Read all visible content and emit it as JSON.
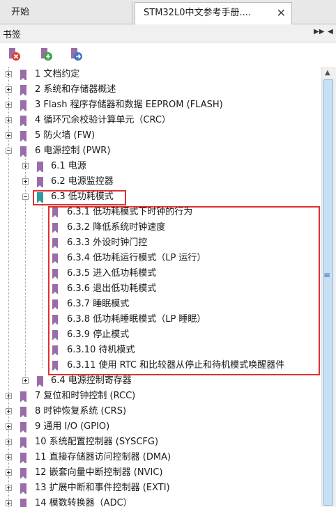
{
  "tabs": {
    "home": "开始",
    "doc": "STM32L0中文参考手册....",
    "close_symbol": "✕"
  },
  "panel": {
    "title": "书签",
    "controls": "▶▶ ◀"
  },
  "toolbar": {
    "delete_icon": "delete-bookmark-icon",
    "add_icon": "add-bookmark-icon",
    "goto_icon": "goto-bookmark-icon"
  },
  "tree": {
    "top": [
      {
        "label": "1 文档约定"
      },
      {
        "label": "2 系统和存储器概述"
      },
      {
        "label": "3 Flash 程序存储器和数据 EEPROM (FLASH)"
      },
      {
        "label": "4 循环冗余校验计算单元（CRC）"
      },
      {
        "label": "5 防火墙 (FW)"
      },
      {
        "label": "6 电源控制 (PWR)"
      }
    ],
    "sec6": [
      {
        "label": "6.1 电源"
      },
      {
        "label": "6.2 电源监控器"
      },
      {
        "label": "6.3 低功耗模式"
      }
    ],
    "sec63": [
      {
        "label": "6.3.1 低功耗模式下时钟的行为"
      },
      {
        "label": "6.3.2 降低系统时钟速度"
      },
      {
        "label": "6.3.3 外设时钟门控"
      },
      {
        "label": "6.3.4 低功耗运行模式（LP 运行）"
      },
      {
        "label": "6.3.5 进入低功耗模式"
      },
      {
        "label": "6.3.6 退出低功耗模式"
      },
      {
        "label": "6.3.7 睡眠模式"
      },
      {
        "label": "6.3.8 低功耗睡眠模式（LP 睡眠）"
      },
      {
        "label": "6.3.9 停止模式"
      },
      {
        "label": "6.3.10 待机模式"
      },
      {
        "label": "6.3.11 使用 RTC 和比较器从停止和待机模式唤醒器件"
      }
    ],
    "sec64": {
      "label": "6.4 电源控制寄存器"
    },
    "rest": [
      {
        "label": "7 复位和时钟控制 (RCC)"
      },
      {
        "label": "8 时钟恢复系统 (CRS)"
      },
      {
        "label": "9 通用 I/O (GPIO)"
      },
      {
        "label": "10 系统配置控制器 (SYSCFG)"
      },
      {
        "label": "11 直接存储器访问控制器 (DMA)"
      },
      {
        "label": "12 嵌套向量中断控制器 (NVIC)"
      },
      {
        "label": "13 扩展中断和事件控制器 (EXTI)"
      },
      {
        "label": "14 模数转换器（ADC）"
      }
    ]
  },
  "colors": {
    "bookmark": "#9a6ca8",
    "bookmark_selected": "#2e9c9c",
    "highlight": "#e03030"
  }
}
